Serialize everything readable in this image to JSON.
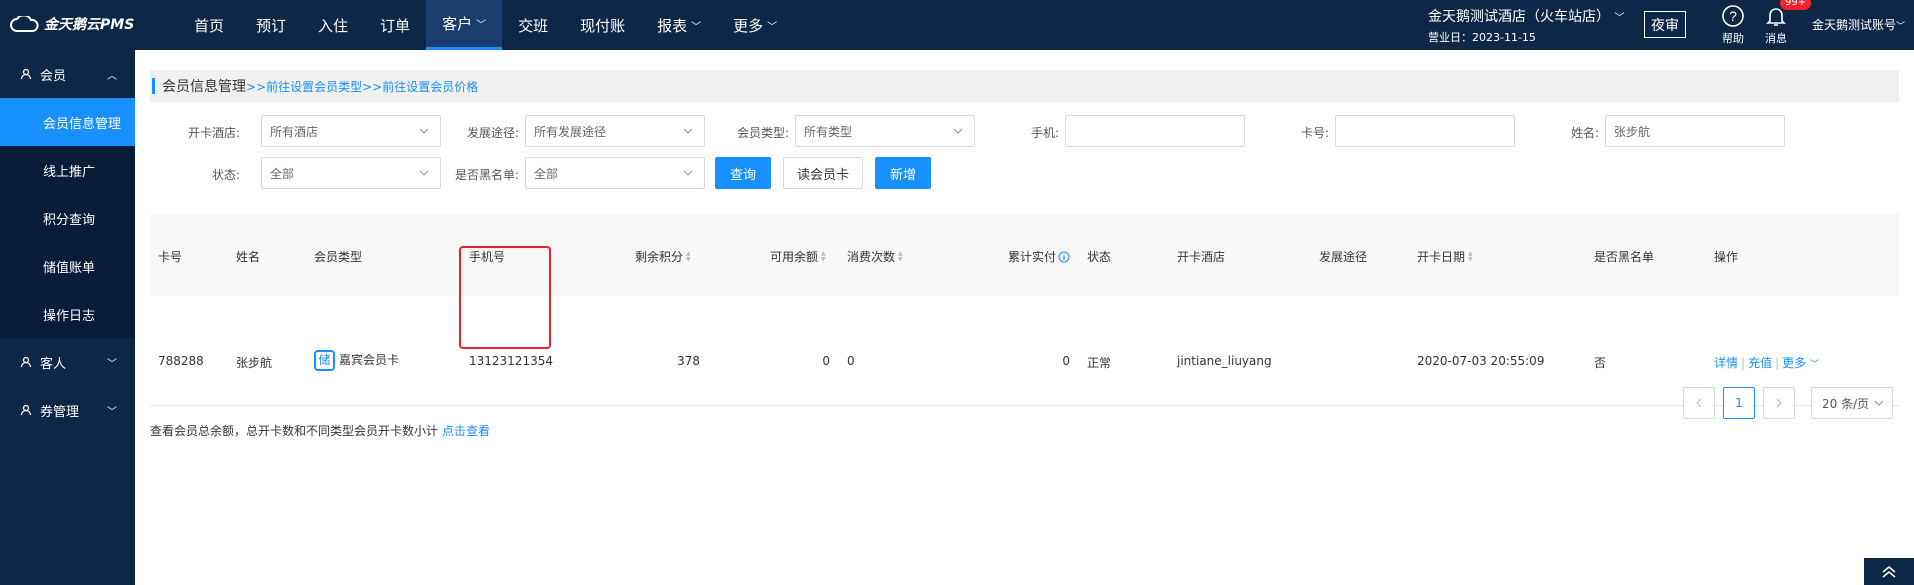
{
  "app": {
    "logo_text": "金天鹅云PMS"
  },
  "nav": [
    {
      "label": "首页",
      "has_menu": false
    },
    {
      "label": "预订",
      "has_menu": false
    },
    {
      "label": "入住",
      "has_menu": false
    },
    {
      "label": "订单",
      "has_menu": false
    },
    {
      "label": "客户",
      "has_menu": true,
      "active": true
    },
    {
      "label": "交班",
      "has_menu": false
    },
    {
      "label": "现付账",
      "has_menu": false
    },
    {
      "label": "报表",
      "has_menu": true
    },
    {
      "label": "更多",
      "has_menu": true
    }
  ],
  "header": {
    "hotel_name": "金天鹅测试酒店（火车站店）",
    "business_date": "营业日：2023-11-15",
    "night_audit": "夜审",
    "help": "帮助",
    "messages": "消息",
    "message_badge": "99+",
    "account": "金天鹅测试账号"
  },
  "sidebar": {
    "member": "会员",
    "member_items": [
      "会员信息管理",
      "线上推广",
      "积分查询",
      "储值账单",
      "操作日志"
    ],
    "guest": "客人",
    "coupon": "券管理"
  },
  "page": {
    "title": "会员信息管理",
    "link1": ">>前往设置会员类型",
    "link2": ">>前往设置会员价格"
  },
  "filters": {
    "hotel_label": "开卡酒店:",
    "hotel_value": "所有酒店",
    "channel_label": "发展途径:",
    "channel_value": "所有发展途径",
    "type_label": "会员类型:",
    "type_value": "所有类型",
    "phone_label": "手机:",
    "phone_value": "",
    "card_label": "卡号:",
    "card_value": "",
    "name_label": "姓名:",
    "name_value": "张步航",
    "status_label": "状态:",
    "status_value": "全部",
    "blacklist_label": "是否黑名单:",
    "blacklist_value": "全部",
    "query_btn": "查询",
    "read_card_btn": "读会员卡",
    "add_btn": "新增"
  },
  "table": {
    "headers": {
      "card": "卡号",
      "name": "姓名",
      "type": "会员类型",
      "phone": "手机号",
      "points": "剩余积分",
      "balance": "可用余额",
      "count": "消费次数",
      "paid": "累计实付",
      "status": "状态",
      "hotel": "开卡酒店",
      "channel": "发展途径",
      "date": "开卡日期",
      "blacklist": "是否黑名单",
      "ops": "操作"
    },
    "rows": [
      {
        "card": "788288",
        "name": "张步航",
        "type_tag": "储",
        "type": "嘉宾会员卡",
        "phone": "13123121354",
        "points": "378",
        "balance": "0",
        "count": "0",
        "paid": "0",
        "status": "正常",
        "hotel": "jintiane_liuyang",
        "channel": "",
        "date": "2020-07-03 20:55:09",
        "blacklist": "否",
        "op_detail": "详情",
        "op_recharge": "充值",
        "op_more": "更多"
      }
    ]
  },
  "pagination": {
    "current": "1",
    "page_size": "20 条/页"
  },
  "summary": {
    "text": "查看会员总余额，总开卡数和不同类型会员开卡数小计",
    "link": "点击查看"
  },
  "colors": {
    "nav_bg": "#0e2747",
    "accent": "#1890ff",
    "highlight": "#e8212b"
  }
}
